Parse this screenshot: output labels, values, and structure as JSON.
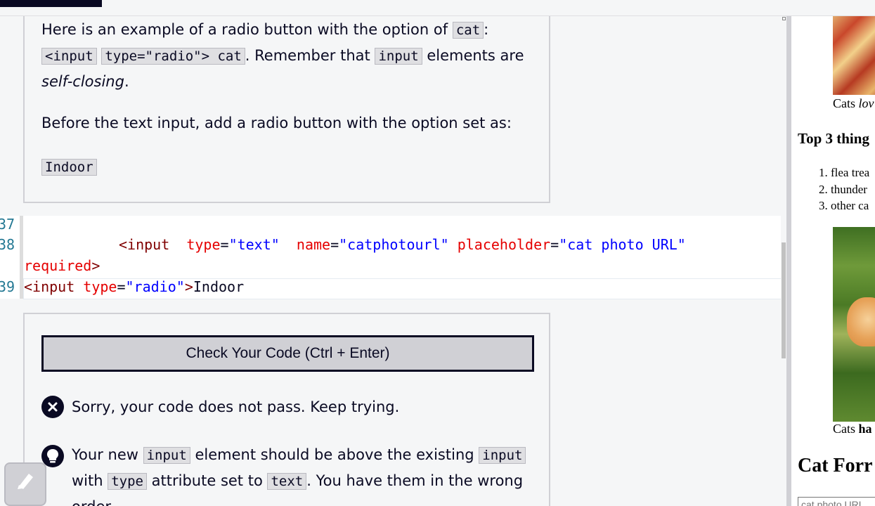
{
  "description": {
    "p1_part1": "Here is an example of a radio button with the option of ",
    "p1_code1": "cat",
    "p1_part2": ": ",
    "p1_code2a": "<input",
    "p1_code2b": "type=\"radio\"> cat",
    "p1_part3": ". Remember that ",
    "p1_code3": "input",
    "p1_part4": " elements are ",
    "p1_em": "self-closing",
    "p1_end": ".",
    "p2": "Before the text input, add a radio button with the option set as:",
    "p3_code": "Indoor"
  },
  "editor": {
    "line_numbers": [
      "37",
      "38",
      "39"
    ],
    "line38_tag_open": "<input",
    "line38_attr1": "type",
    "line38_eq1": "=",
    "line38_val1": "\"text\"",
    "line38_attr2": "name",
    "line38_eq2": "=",
    "line38_val2": "\"catphotourl\"",
    "line38_attr3": "placeholder",
    "line38_eq3": "=",
    "line38_val3": "\"cat photo URL\"",
    "line38_attr4": "required",
    "line38_close": ">",
    "line39_tag_open": "<input",
    "line39_attr": "type",
    "line39_eq": "=",
    "line39_val": "\"radio\"",
    "line39_close": ">",
    "line39_text": "Indoor"
  },
  "tests": {
    "check_button": "Check Your Code (Ctrl + Enter)",
    "fail_message": "Sorry, your code does not pass. Keep trying.",
    "hint_1": "Your new ",
    "hint_code1": "input",
    "hint_2": " element should be above the existing ",
    "hint_code2": "input",
    "hint_3": "with ",
    "hint_code3": "type",
    "hint_4": " attribute set to ",
    "hint_code4": "text",
    "hint_5": ". You have them in the wrong order."
  },
  "preview": {
    "caption1_a": "Cats ",
    "caption1_b": "lov",
    "heading3": "Top 3 thing",
    "list": [
      "flea trea",
      "thunder",
      "other ca"
    ],
    "caption2_a": "Cats ",
    "caption2_b": "ha",
    "heading2": "Cat Forr",
    "input_placeholder": "cat photo URL"
  },
  "colors": {
    "dark": "#0a0a23",
    "button_bg": "#d0d0d5",
    "code_bg": "#dfdfe2"
  }
}
